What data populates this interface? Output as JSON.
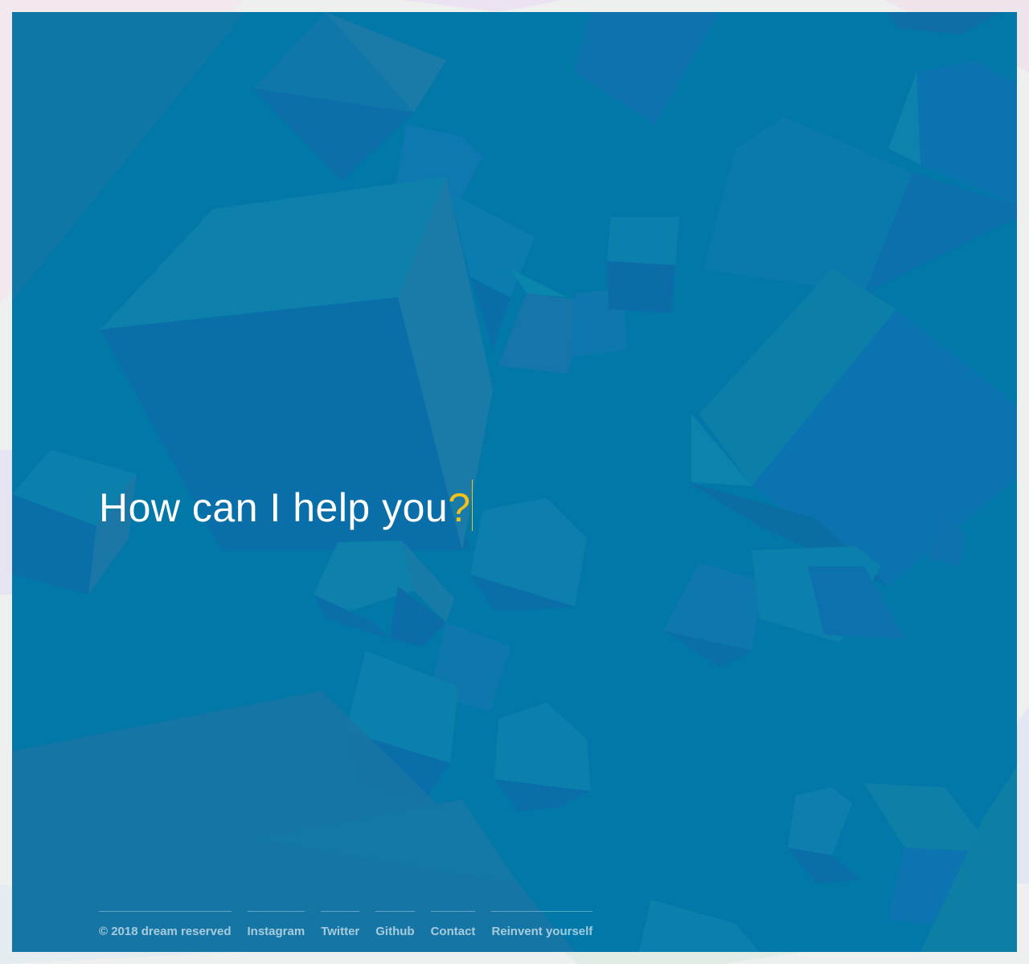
{
  "headline": {
    "text": "How can I help you",
    "punctuation": "?"
  },
  "footer": {
    "copyright": "© 2018 dream reserved",
    "links": [
      "Instagram",
      "Twitter",
      "Github",
      "Contact",
      "Reinvent yourself"
    ]
  },
  "colors": {
    "background": "#0278a9",
    "accent": "#f2c21a",
    "outer": "#eeefef"
  }
}
